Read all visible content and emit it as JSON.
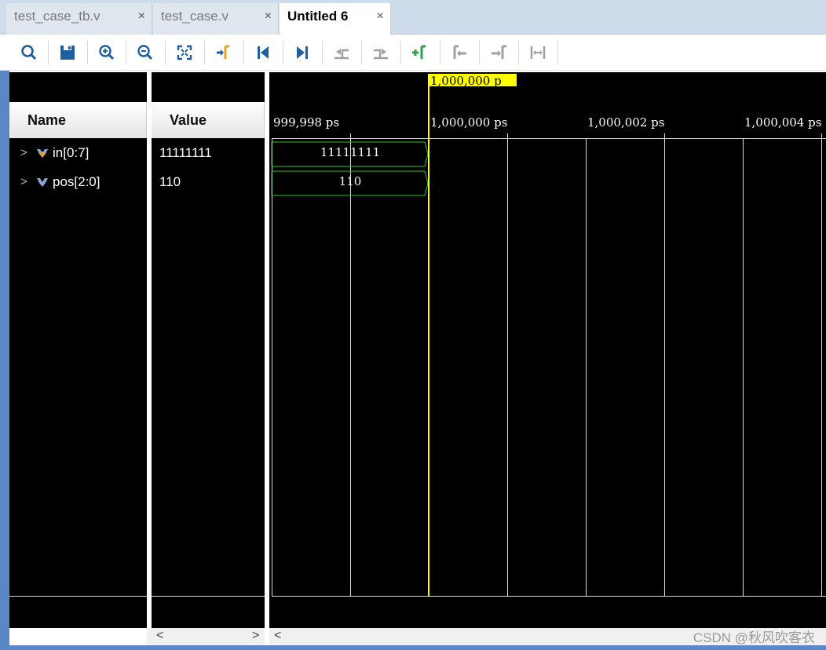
{
  "tabs": [
    {
      "label": "test_case_tb.v",
      "close": "×"
    },
    {
      "label": "test_case.v",
      "close": "×"
    },
    {
      "label": "Untitled 6",
      "close": "×"
    }
  ],
  "toolbar": {
    "buttons": [
      "search-icon",
      "save-icon",
      "zoom-in-icon",
      "zoom-out-icon",
      "zoom-fit-icon",
      "go-to-cursor-icon",
      "go-to-time-zero-icon",
      "go-to-last-time-icon",
      "previous-transition-icon",
      "next-transition-icon",
      "add-marker-icon",
      "previous-marker-icon",
      "next-marker-icon",
      "swap-cursors-icon"
    ]
  },
  "columns": {
    "name": "Name",
    "value": "Value"
  },
  "signals": [
    {
      "name": "in[0:7]",
      "value": "11111111",
      "wave_value": "11111111"
    },
    {
      "name": "pos[2:0]",
      "value": "110",
      "wave_value": "110"
    }
  ],
  "cursor": {
    "label": "1,000,000 p"
  },
  "time_axis": [
    "999,998 ps",
    "1,000,000 ps",
    "1,000,002 ps",
    "1,000,004 ps"
  ],
  "colors": {
    "wave": "#2ec52e",
    "cursor": "#ffff00",
    "background": "#000000"
  },
  "scroll": {
    "left": "<",
    "right": ">"
  },
  "watermark": "CSDN @秋风吹客衣"
}
